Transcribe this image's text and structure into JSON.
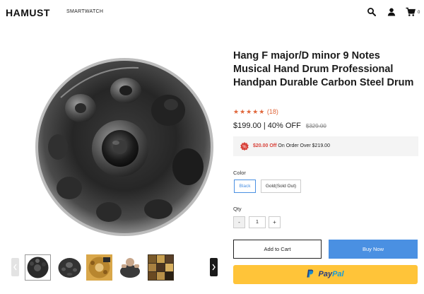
{
  "header": {
    "logo": "HAMUST",
    "nav": [
      "SMARTWATCH"
    ],
    "cart_count": "0",
    "icons": [
      "search-icon",
      "user-icon",
      "cart-icon"
    ]
  },
  "product": {
    "title": "Hang F major/D minor 9 Notes Musical Hand Drum Professional Handpan Durable Carbon Steel Drum",
    "stars": "★★★★★",
    "rating_count": "(18)",
    "price": "$199.00",
    "discount": "| 40% OFF",
    "old_price": "$329.00",
    "promo": {
      "amount": "$20.00 Off",
      "text": "On Order Over $219.00"
    },
    "color_label": "Color",
    "colors": [
      {
        "label": "Black",
        "selected": true
      },
      {
        "label": "Gold(Sold Out)",
        "selected": false
      }
    ],
    "qty_label": "Qty",
    "qty_minus": "-",
    "qty_value": "1",
    "qty_plus": "+",
    "add_to_cart": "Add to Cart",
    "buy_now": "Buy Now",
    "paypal_pay": "Pay",
    "paypal_pal": "Pal"
  },
  "gallery": {
    "thumbnail_count": 5,
    "active_index": 0
  },
  "colors": {
    "accent_blue": "#4a90e2",
    "rating_orange": "#e0663a",
    "promo_red": "#d8423a",
    "paypal_yellow": "#ffc439"
  }
}
